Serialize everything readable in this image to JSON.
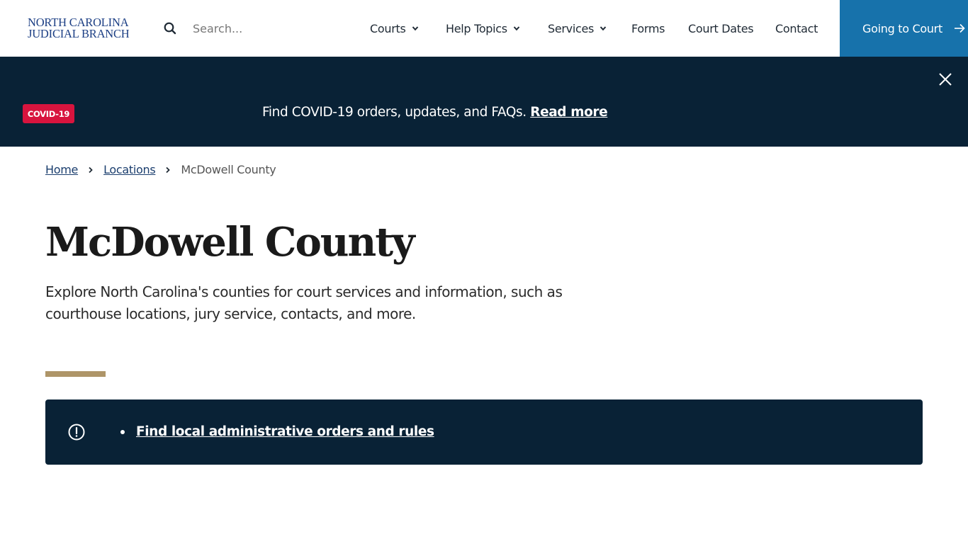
{
  "header": {
    "logo_line1": "NORTH CAROLINA",
    "logo_line2": "JUDICIAL BRANCH",
    "search": {
      "placeholder": "Search...",
      "value": "",
      "icon": "search-icon"
    },
    "nav": [
      {
        "label": "Courts",
        "has_dropdown": true
      },
      {
        "label": "Help Topics",
        "has_dropdown": true
      },
      {
        "label": "Services",
        "has_dropdown": true
      },
      {
        "label": "Forms",
        "has_dropdown": false
      },
      {
        "label": "Court Dates",
        "has_dropdown": false
      },
      {
        "label": "Contact",
        "has_dropdown": false
      }
    ],
    "cta": {
      "label": "Going to Court",
      "icon": "arrow-right-icon",
      "color": "#1772ab"
    }
  },
  "banner": {
    "badge": "COVID-19",
    "badge_color": "#d8143e",
    "text": "Find COVID-19 orders, updates, and FAQs.",
    "link_label": "Read more",
    "background": "#092236",
    "close_icon": "close-icon"
  },
  "breadcrumb": {
    "items": [
      {
        "label": "Home",
        "link": true
      },
      {
        "label": "Locations",
        "link": true
      },
      {
        "label": "McDowell County",
        "link": false
      }
    ]
  },
  "main": {
    "title": "McDowell County",
    "intro": "Explore North Carolina's counties for court services and information, such as courthouse locations, jury service, contacts, and more.",
    "accent_color": "#ae9568",
    "info_box": {
      "icon": "alert-circle-icon",
      "links": [
        {
          "label": "Find local administrative orders and rules"
        }
      ]
    }
  }
}
